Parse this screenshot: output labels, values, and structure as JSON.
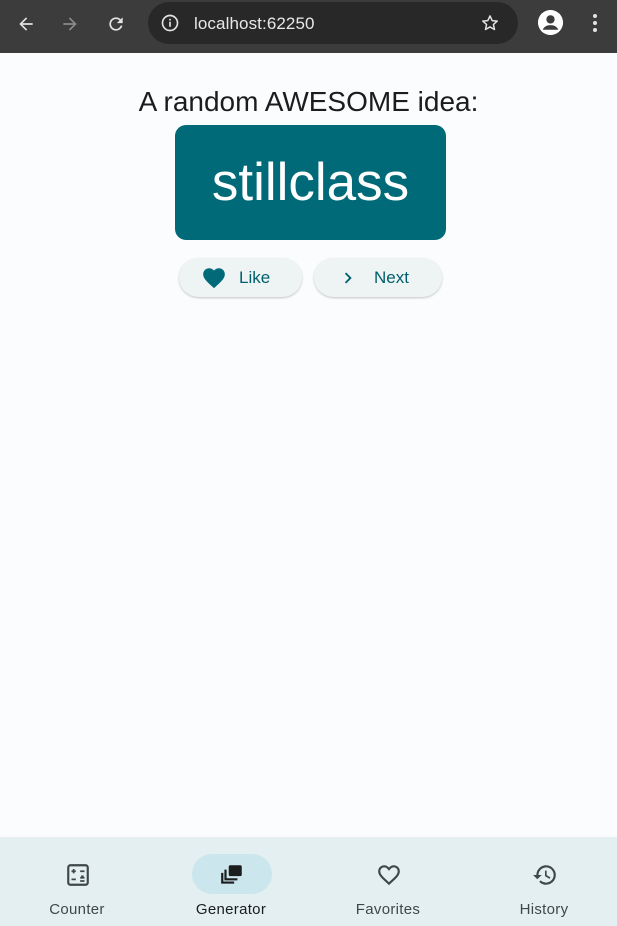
{
  "browser": {
    "url": "localhost:62250",
    "icons": [
      "back-icon",
      "forward-icon",
      "reload-icon",
      "info-icon",
      "star-icon",
      "profile-icon",
      "more-vert-icon"
    ]
  },
  "main": {
    "headline": "A random AWESOME idea:",
    "word": "stillclass",
    "like_label": "Like",
    "next_label": "Next",
    "accent_color": "#006a78"
  },
  "bottom_nav": {
    "items": [
      {
        "label": "Counter",
        "icon": "calculator-icon",
        "active": false
      },
      {
        "label": "Generator",
        "icon": "cards-icon",
        "active": true
      },
      {
        "label": "Favorites",
        "icon": "heart-outline-icon",
        "active": false
      },
      {
        "label": "History",
        "icon": "history-icon",
        "active": false
      }
    ]
  }
}
